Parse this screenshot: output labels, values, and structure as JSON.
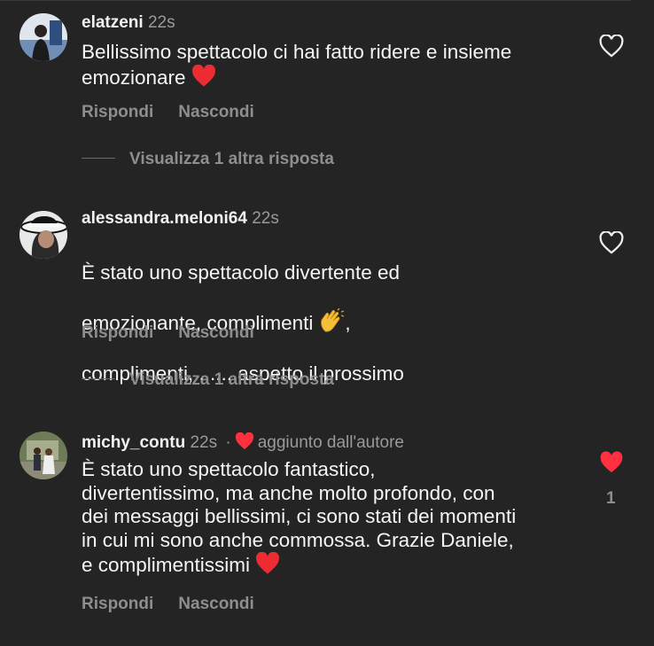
{
  "comments": [
    {
      "username": "elatzeni",
      "time": "22s",
      "text": "Bellissimo spettacolo ci hai fatto ridere e insieme emozionare",
      "emoji": "red-heart-emoji",
      "reply_label": "Rispondi",
      "hide_label": "Nascondi",
      "liked": false,
      "view_replies": "Visualizza 1 altra risposta"
    },
    {
      "username": "alessandra.meloni64",
      "time": "22s",
      "text_line1": "È stato uno spettacolo divertente ed",
      "text_line2": "emozionante, complimenti",
      "text_line2_after": ",",
      "text_line3": "complimenti, .......aspetto  il prossimo",
      "emoji": "clapping-hands-emoji",
      "reply_label": "Rispondi",
      "hide_label": "Nascondi",
      "liked": false,
      "view_replies": "Visualizza 1 altra risposta"
    },
    {
      "username": "michy_contu",
      "time": "22s",
      "separator": "·",
      "author_note": "aggiunto dall'autore",
      "text": "È stato uno spettacolo fantastico,\ndivertentissimo, ma anche molto profondo, con\ndei messaggi bellissimi, ci sono stati dei momenti\nin cui mi sono anche commossa. Grazie Daniele,\ne complimentissimi",
      "emoji": "red-heart-emoji",
      "reply_label": "Rispondi",
      "hide_label": "Nascondi",
      "liked": true,
      "like_count": "1"
    }
  ],
  "colors": {
    "background": "#242424",
    "muted": "#8e8e8e",
    "like_red": "#ff3040"
  }
}
